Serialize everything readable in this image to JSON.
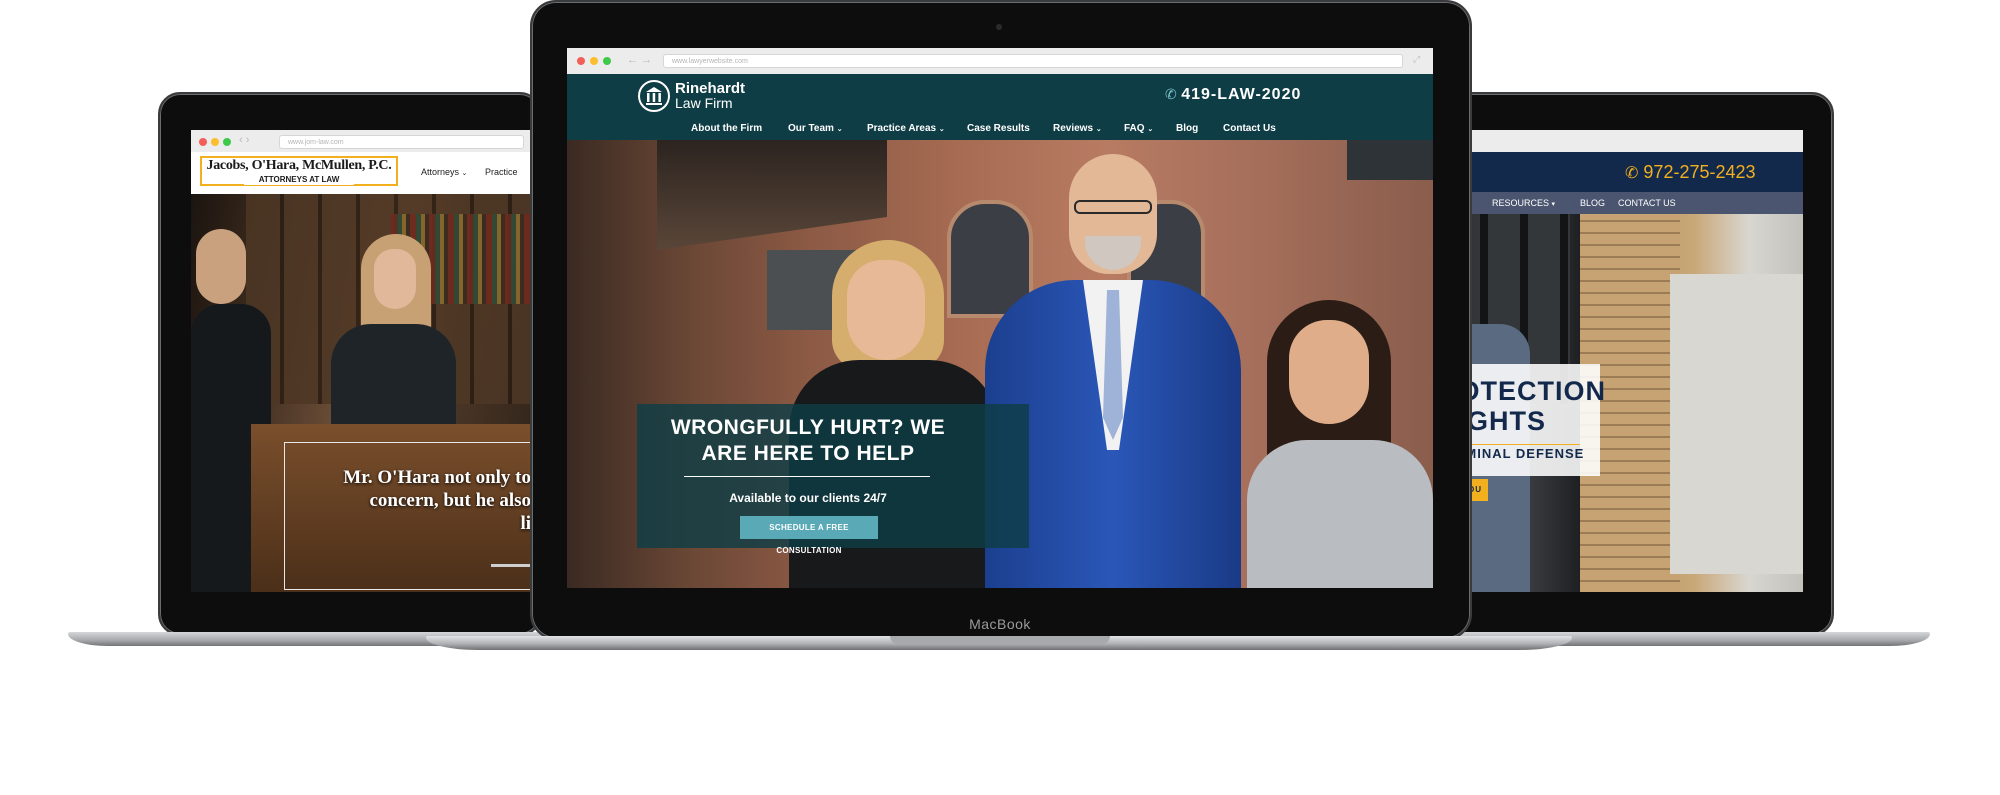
{
  "left_site": {
    "browser_url": "www.jom-law.com",
    "logo_name": "Jacobs, O'Hara, McMullen, P.C.",
    "logo_sub": "ATTORNEYS AT LAW",
    "nav": [
      "Attorneys",
      "Practice"
    ],
    "quote_line1": "Mr. O'Hara not only to",
    "quote_line2": "concern, but he also",
    "quote_line3": "li"
  },
  "center_site": {
    "browser_url": "www.lawyerwebsite.com",
    "logo_line1": "Rinehardt",
    "logo_line2": "Law Firm",
    "phone": "419-LAW-2020",
    "nav": [
      {
        "label": "About the Firm",
        "dropdown": false
      },
      {
        "label": "Our Team",
        "dropdown": true
      },
      {
        "label": "Practice Areas",
        "dropdown": true
      },
      {
        "label": "Case Results",
        "dropdown": false
      },
      {
        "label": "Reviews",
        "dropdown": true
      },
      {
        "label": "FAQ",
        "dropdown": true
      },
      {
        "label": "Blog",
        "dropdown": false
      },
      {
        "label": "Contact Us",
        "dropdown": false
      }
    ],
    "hero_line1": "WRONGFULLY HURT? WE",
    "hero_line2": "ARE HERE TO HELP",
    "hero_sub": "Available to our clients 24/7",
    "cta": "SCHEDULE A FREE CONSULTATION"
  },
  "right_site": {
    "phone": "972-275-2423",
    "nav": [
      "RESOURCES",
      "BLOG",
      "CONTACT US"
    ],
    "hero_line1": "ROTECTION",
    "hero_line2": "RIGHTS",
    "hero_sub": "CRIMINAL DEFENSE",
    "cta": "CT YOU"
  },
  "device_label": "MacBook",
  "colors": {
    "center_header": "#0f3d45",
    "center_cta": "#5aa9b7",
    "right_header": "#13294b",
    "right_phone": "#f2b01e",
    "left_logo_border": "#f2b01e"
  }
}
